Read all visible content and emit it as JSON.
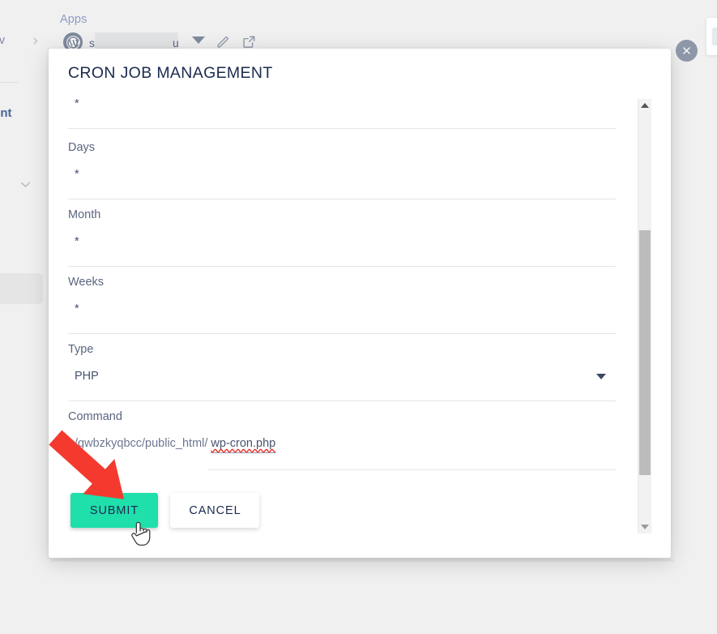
{
  "background": {
    "breadcrumb_apps": "Apps",
    "breadcrumb_server_partial": "erv",
    "breadcrumb_separator": "›",
    "site_name_prefix": "s",
    "site_name_suffix": "u",
    "site_name_redacted": true,
    "icons": {
      "wordpress": "wordpress-icon",
      "caret": "chevron-down-icon",
      "pencil": "edit-pencil-icon",
      "external": "external-link-icon"
    },
    "left_partial_text": "ent",
    "left_chevron": "chevron-down-icon"
  },
  "close_button": {
    "label": "✕",
    "name": "close-icon"
  },
  "modal": {
    "title": "CRON JOB MANAGEMENT",
    "fields": [
      {
        "label": "",
        "value": "*",
        "type": "text",
        "show_label": false
      },
      {
        "label": "Days",
        "value": "*",
        "type": "text",
        "show_label": true
      },
      {
        "label": "Month",
        "value": "*",
        "type": "text",
        "show_label": true
      },
      {
        "label": "Weeks",
        "value": "*",
        "type": "text",
        "show_label": true
      },
      {
        "label": "Type",
        "value": "PHP",
        "type": "select",
        "show_label": true
      }
    ],
    "command": {
      "label": "Command",
      "prefix": "/gwbzkyqbcc/public_html/",
      "value": "wp-cron.php",
      "spellcheck_error": true
    },
    "actions": {
      "submit_label": "SUBMIT",
      "cancel_label": "CANCEL"
    },
    "scrollbar": {
      "up_arrow": "▲",
      "down_arrow": "▼",
      "thumb_position_pct": 30
    }
  },
  "colors": {
    "submit_green": "#1fdfab",
    "title_navy": "#1b2a4e",
    "label_gray": "#5a6580",
    "page_background": "#f0f0f0",
    "annotation_red": "#f43a2e",
    "close_gray": "#8d97a9"
  },
  "annotation": {
    "arrow": "red-arrow-pointing-to-submit",
    "cursor": "hand-pointer-cursor"
  }
}
